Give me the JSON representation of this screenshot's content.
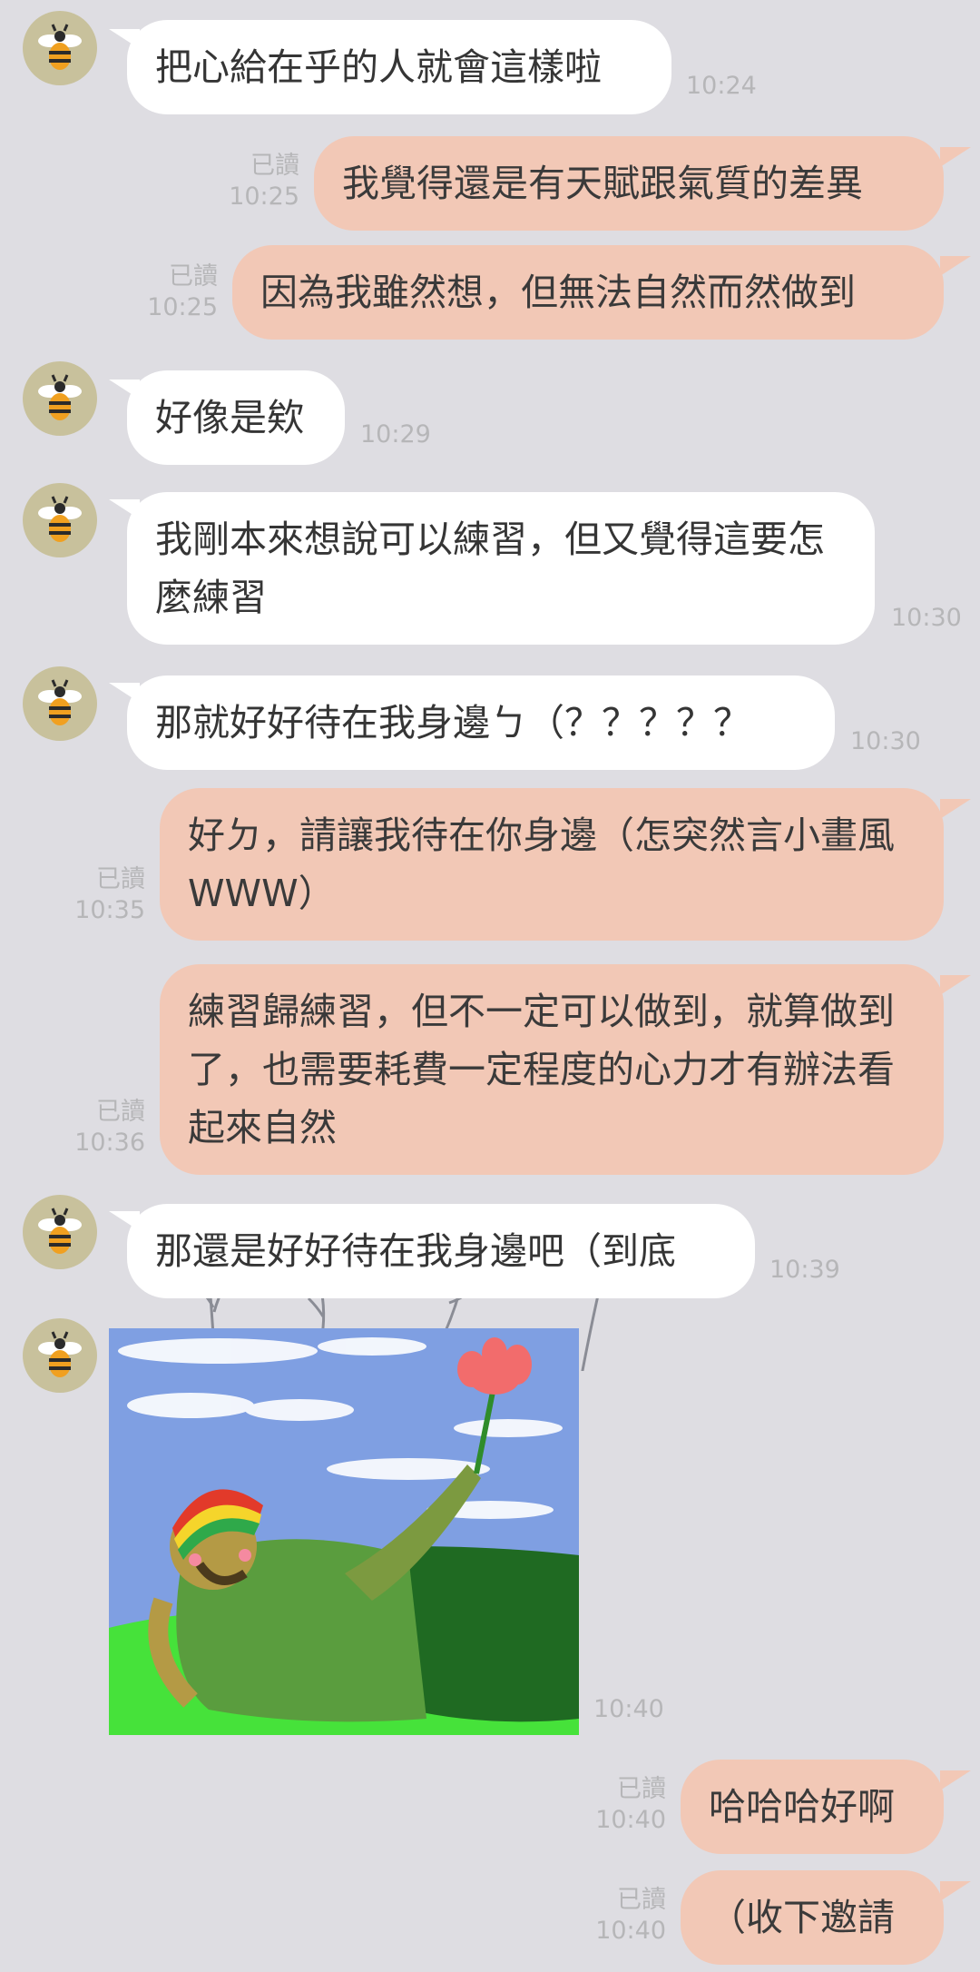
{
  "messages": [
    {
      "side": "in",
      "text": "把心給在乎的人就會這樣啦",
      "time": "10:24"
    },
    {
      "side": "out",
      "text": "我覺得還是有天賦跟氣質的差異",
      "read": "已讀",
      "time": "10:25"
    },
    {
      "side": "out",
      "text": "因為我雖然想，但無法自然而然做到",
      "read": "已讀",
      "time": "10:25"
    },
    {
      "side": "in",
      "text": "好像是欸",
      "time": "10:29"
    },
    {
      "side": "in",
      "text": "我剛本來想說可以練習，但又覺得這要怎麼練習",
      "time": "10:30"
    },
    {
      "side": "in",
      "text": "那就好好待在我身邊ㄅ（？？？？？",
      "time": "10:30"
    },
    {
      "side": "out",
      "text": "好ㄉ，請讓我待在你身邊（怎突然言小畫風WWW）",
      "read": "已讀",
      "time": "10:35"
    },
    {
      "side": "out",
      "text": "練習歸練習，但不一定可以做到，就算做到了，也需要耗費一定程度的心力才有辦法看起來自然",
      "read": "已讀",
      "time": "10:36"
    },
    {
      "side": "in",
      "text": "那還是好好待在我身邊吧（到底",
      "time": "10:39"
    },
    {
      "side": "in",
      "type": "sticker",
      "time": "10:40"
    },
    {
      "side": "out",
      "text": "哈哈哈好啊",
      "read": "已讀",
      "time": "10:40"
    },
    {
      "side": "out",
      "text": "（收下邀請",
      "read": "已讀",
      "time": "10:40"
    }
  ],
  "avatar_icon": "bee-icon",
  "sticker_icon": "reclining-man-with-flower-sticker",
  "colors": {
    "background": "#dedde2",
    "incoming": "#ffffff",
    "outgoing": "#f2c8b6",
    "meta": "#b6b6b8"
  }
}
